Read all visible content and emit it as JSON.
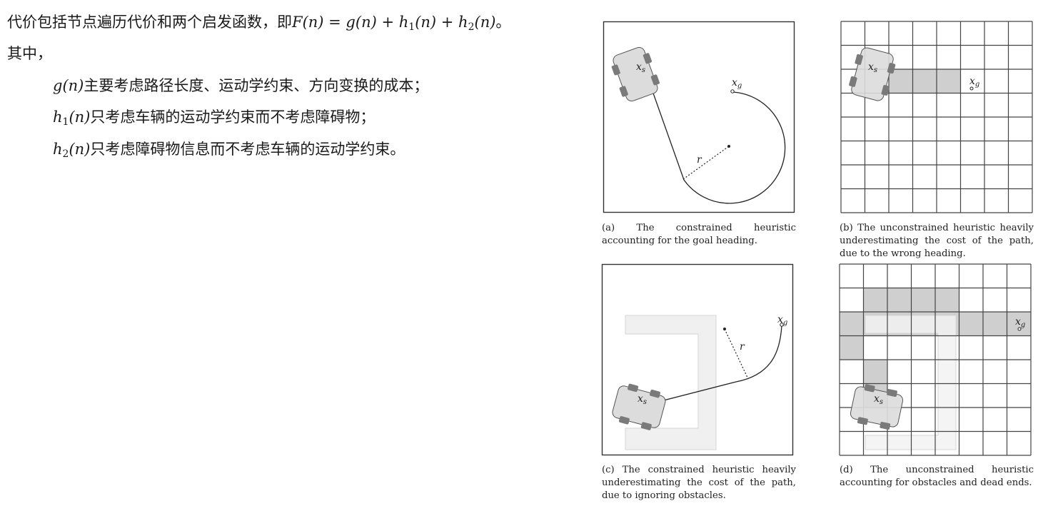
{
  "text": {
    "line1_prefix": "代价包括节点遍历代价和两个启发函数，即",
    "formula_F": "F(n) = g(n) + h",
    "formula_sub1": "1",
    "formula_mid": "(n) + h",
    "formula_sub2": "2",
    "formula_end": "(n)",
    "line1_suffix": "。",
    "line2": "其中，",
    "item1_math": "g(n)",
    "item1_text": "主要考虑路径长度、运动学约束、方向变换的成本；",
    "item2_math_h": "h",
    "item2_sub": "1",
    "item2_math_n": "(n)",
    "item2_text": "只考虑车辆的运动学约束而不考虑障碍物；",
    "item3_math_h": "h",
    "item3_sub": "2",
    "item3_math_n": "(n)",
    "item3_text": "只考虑障碍物信息而不考虑车辆的运动学约束。"
  },
  "figure": {
    "labels": {
      "xs": "x",
      "xs_sub": "s",
      "xg": "x",
      "xg_sub": "g",
      "r": "r"
    },
    "captions": {
      "a": "(a) The constrained heuristic accounting for the goal heading.",
      "b": "(b) The unconstrained heuristic heavily underestimating the cost of the path, due to the wrong heading.",
      "c": "(c) The constrained heuristic heavily underestimating the cost of the path, due to ignoring obstacles.",
      "d": "(d) The unconstrained heuristic accounting for obstacles and dead ends."
    },
    "colors": {
      "line": "#333333",
      "grid": "#444444",
      "shade": "#cfcfcf",
      "obstacle": "#f0f0f0",
      "car_body": "#dcdcdc",
      "wheel": "#7a7a7a"
    }
  }
}
